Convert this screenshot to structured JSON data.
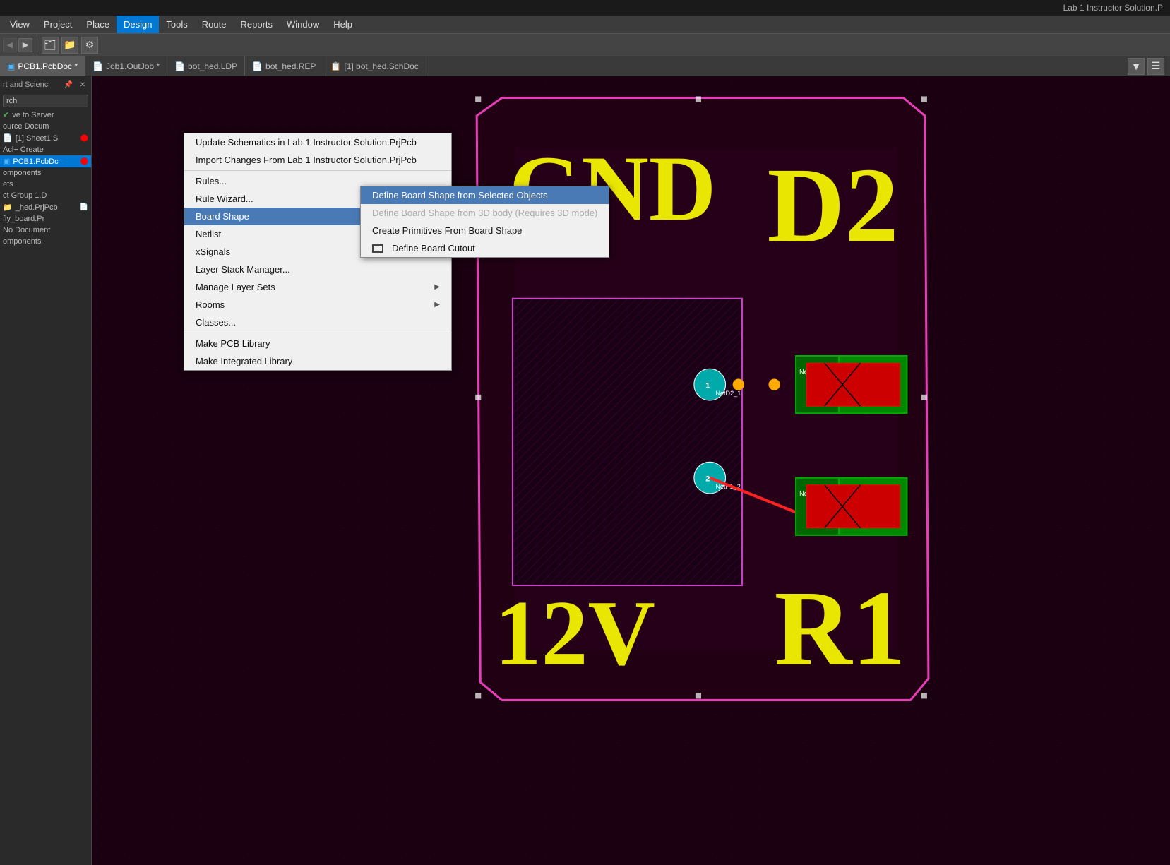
{
  "titleBar": {
    "text": "Lab 1 Instructor Solution.P"
  },
  "menuBar": {
    "items": [
      {
        "id": "view",
        "label": "View"
      },
      {
        "id": "project",
        "label": "Project"
      },
      {
        "id": "place",
        "label": "Place"
      },
      {
        "id": "design",
        "label": "Design",
        "active": true
      },
      {
        "id": "tools",
        "label": "Tools"
      },
      {
        "id": "route",
        "label": "Route"
      },
      {
        "id": "reports",
        "label": "Reports"
      },
      {
        "id": "window",
        "label": "Window"
      },
      {
        "id": "help",
        "label": "Help"
      }
    ]
  },
  "tabs": [
    {
      "id": "pcb1",
      "label": "PCB1.PcbDoc",
      "active": true,
      "icon": "pcb",
      "modified": true
    },
    {
      "id": "job1",
      "label": "Job1.OutJob",
      "active": false,
      "icon": "job",
      "modified": true
    },
    {
      "id": "ldp",
      "label": "bot_hed.LDP",
      "active": false,
      "icon": "ldp"
    },
    {
      "id": "rep",
      "label": "bot_hed.REP",
      "active": false,
      "icon": "rep"
    },
    {
      "id": "schdoc",
      "label": "[1] bot_hed.SchDoc",
      "active": false,
      "icon": "sch"
    }
  ],
  "leftPanel": {
    "searchPlaceholder": "rch",
    "sections": [
      {
        "label": "rt and Scienc",
        "items": []
      }
    ],
    "items": [
      {
        "label": "ve to Server",
        "status": "check",
        "selected": false
      },
      {
        "label": "ource Docum",
        "selected": false
      },
      {
        "label": "[1] Sheet1.S",
        "selected": false,
        "hasIcon": true
      },
      {
        "label": "Acl+ Create",
        "selected": false
      },
      {
        "label": "PCB1.PcbDc",
        "selected": true,
        "hasIcon": true
      },
      {
        "label": "omponents",
        "selected": false
      },
      {
        "label": "ets",
        "selected": false
      },
      {
        "label": "ct Group 1.D",
        "selected": false
      },
      {
        "label": "_hed.PrjPcb",
        "selected": false,
        "hasIcon": true
      },
      {
        "label": "fly_board.Pr",
        "selected": false
      },
      {
        "label": "No Document",
        "selected": false
      },
      {
        "label": "omponents",
        "selected": false
      }
    ]
  },
  "designMenu": {
    "items": [
      {
        "id": "update-schematics",
        "label": "Update Schematics in Lab 1 Instructor Solution.PrjPcb",
        "disabled": false
      },
      {
        "id": "import-changes",
        "label": "Import Changes From Lab 1 Instructor Solution.PrjPcb",
        "disabled": false
      },
      {
        "separator": true
      },
      {
        "id": "rules",
        "label": "Rules...",
        "disabled": false
      },
      {
        "id": "rule-wizard",
        "label": "Rule Wizard...",
        "disabled": false
      },
      {
        "id": "board-shape",
        "label": "Board Shape",
        "hasSubmenu": true,
        "highlighted": true
      },
      {
        "id": "netlist",
        "label": "Netlist",
        "hasSubmenu": true
      },
      {
        "id": "xsignals",
        "label": "xSignals",
        "hasSubmenu": true
      },
      {
        "id": "layer-stack",
        "label": "Layer Stack Manager...",
        "disabled": false
      },
      {
        "id": "manage-layer-sets",
        "label": "Manage Layer Sets",
        "hasSubmenu": true
      },
      {
        "id": "rooms",
        "label": "Rooms",
        "hasSubmenu": true
      },
      {
        "id": "classes",
        "label": "Classes...",
        "disabled": false
      },
      {
        "separator2": true
      },
      {
        "id": "make-pcb-library",
        "label": "Make PCB Library",
        "disabled": false
      },
      {
        "id": "make-integrated",
        "label": "Make Integrated Library",
        "disabled": false
      }
    ]
  },
  "boardShapeSubmenu": {
    "items": [
      {
        "id": "define-from-selected",
        "label": "Define Board Shape from Selected Objects",
        "selected": true
      },
      {
        "id": "define-from-3d",
        "label": "Define Board Shape from 3D body (Requires 3D mode)",
        "disabled": true
      },
      {
        "id": "create-primitives",
        "label": "Create Primitives From Board Shape",
        "disabled": false
      },
      {
        "id": "define-cutout",
        "label": "Define Board Cutout",
        "disabled": false,
        "hasIcon": true
      }
    ]
  },
  "filterIcon": "▼",
  "toolbar": {
    "icons": [
      "🗂",
      "📁",
      "⚙"
    ]
  }
}
